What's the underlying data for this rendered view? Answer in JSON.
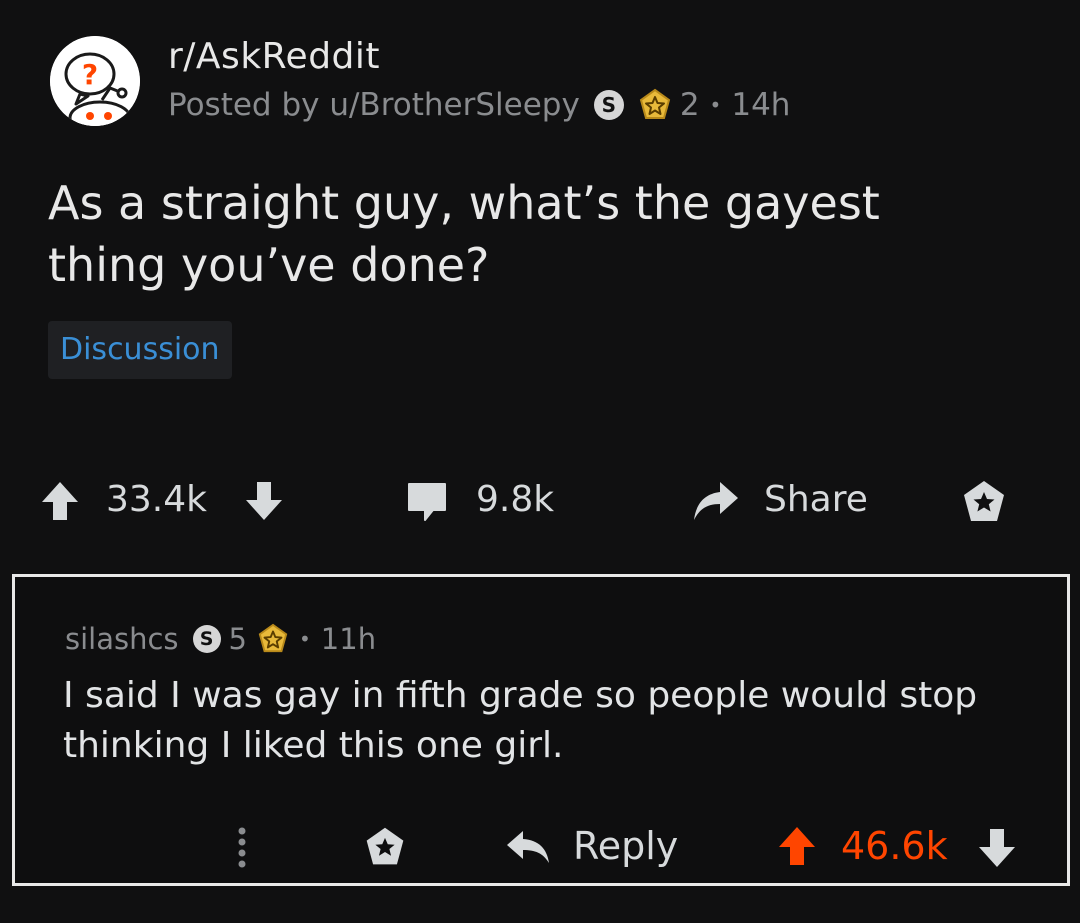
{
  "post": {
    "subreddit": "r/AskReddit",
    "posted_by": "Posted by u/BrotherSleepy",
    "author_badge_letter": "S",
    "award_count": "2",
    "separator": "•",
    "age": "14h",
    "title": "As a straight guy, what’s the gayest thing you’ve done?",
    "flair": "Discussion",
    "upvotes": "33.4k",
    "comments": "9.8k",
    "share_label": "Share",
    "icons": [
      "subreddit-avatar-icon",
      "snoo-badge-icon",
      "star-award-icon",
      "upvote-icon",
      "downvote-icon",
      "comment-icon",
      "share-icon",
      "award-icon"
    ]
  },
  "comment": {
    "author": "silashcs",
    "badge_letter": "S",
    "award_count": "5",
    "separator": "•",
    "age": "11h",
    "body": "I said I was gay in fifth grade so people would stop thinking I liked this one girl.",
    "reply_label": "Reply",
    "upvotes": "46.6k",
    "icons": [
      "more-options-icon",
      "award-icon",
      "reply-icon",
      "upvote-icon",
      "downvote-icon"
    ]
  },
  "colors": {
    "background": "#101011",
    "text": "#d7dadc",
    "muted": "#8a8c8f",
    "flair_text": "#3a8fd6",
    "upvoted": "#ff4500",
    "award_gold": "#e8b93a"
  }
}
